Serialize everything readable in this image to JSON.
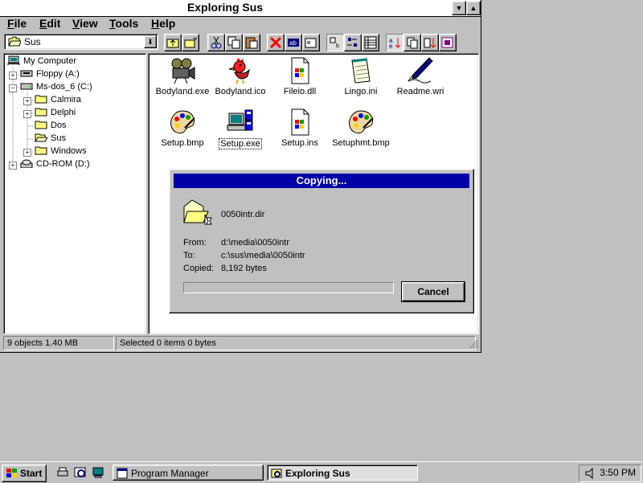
{
  "window": {
    "title": "Exploring Sus",
    "minimize_glyph": "▼",
    "maximize_glyph": "▲"
  },
  "menu": [
    "File",
    "Edit",
    "View",
    "Tools",
    "Help"
  ],
  "toolbar": {
    "location_value": "Sus",
    "icons": [
      "up-folder-icon",
      "new-folder-icon",
      "cut-icon",
      "copy-icon",
      "paste-icon",
      "delete-icon",
      "rename-icon",
      "properties-icon",
      "large-icons-view",
      "small-icons-view",
      "list-view",
      "details-view",
      "sort-name",
      "sort-type",
      "sort-size",
      "sort-date"
    ]
  },
  "tree": [
    {
      "label": "My Computer",
      "icon": "computer-icon"
    },
    {
      "label": "Floppy (A:)",
      "icon": "floppy-drive-icon"
    },
    {
      "label": "Ms-dos_6 (C:)",
      "icon": "hard-drive-icon"
    },
    {
      "label": "Calmira",
      "icon": "folder-icon"
    },
    {
      "label": "Delphi",
      "icon": "folder-icon"
    },
    {
      "label": "Dos",
      "icon": "folder-icon"
    },
    {
      "label": "Sus",
      "icon": "open-folder-icon"
    },
    {
      "label": "Windows",
      "icon": "folder-icon"
    },
    {
      "label": "CD-ROM (D:)",
      "icon": "cdrom-drive-icon"
    }
  ],
  "files": [
    {
      "label": "Bodyland.exe",
      "icon": "projector-icon"
    },
    {
      "label": "Bodyland.ico",
      "icon": "rooster-icon"
    },
    {
      "label": "Fileio.dll",
      "icon": "dll-icon"
    },
    {
      "label": "Lingo.ini",
      "icon": "notepad-icon"
    },
    {
      "label": "Readme.wri",
      "icon": "write-pen-icon"
    },
    {
      "label": "Setup.bmp",
      "icon": "palette-icon"
    },
    {
      "label": "Setup.exe",
      "icon": "setup-computer-icon"
    },
    {
      "label": "Setup.ins",
      "icon": "ins-icon"
    },
    {
      "label": "Setuphmt.bmp",
      "icon": "palette-icon"
    }
  ],
  "status": {
    "objects": "9 objects  1.40 MB",
    "selected": "Selected 0 items  0 bytes"
  },
  "dialog": {
    "title": "Copying...",
    "filename": "0050intr.dir",
    "from_label": "From:",
    "from_value": "d:\\media\\0050intr",
    "to_label": "To:",
    "to_value": "c:\\sus\\media\\0050intr",
    "copied_label": "Copied:",
    "copied_value": "8,192 bytes",
    "cancel_label": "Cancel",
    "progress": 0
  },
  "taskbar": {
    "start_label": "Start",
    "tasks": [
      "Program Manager",
      "Exploring Sus"
    ],
    "clock": "3:50 PM"
  }
}
